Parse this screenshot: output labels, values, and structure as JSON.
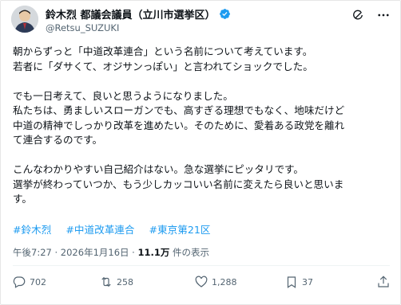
{
  "post": {
    "author_name": "鈴木烈 都議会議員（立川市選挙区）",
    "author_handle": "@Retsu_SUZUKI",
    "lines": [
      "朝からずっと「中道改革連合」という名前について考えています。",
      "若者に「ダサくて、オジサンっぽい」と言われてショックでした。",
      "",
      "でも一日考えて、良いと思うようになりました。",
      "私たちは、勇ましいスローガンでも、高すぎる理想でもなく、地味だけど",
      "中道の精神でしっかり改革を進めたい。そのために、愛着ある政党を離れ",
      "て連合するのです。",
      "",
      "こんなわかりやすい自己紹介はない。急な選挙にピッタリです。",
      "選挙が終わっていつか、もう少しカッコいい名前に変えたら良いと思いま",
      "す。"
    ],
    "hashtags": [
      "#鈴木烈",
      "#中道改革連合",
      "#東京第21区"
    ],
    "time": "午後7:27",
    "date": "2026年1月16日",
    "views_count": "11.1万",
    "views_label": "件の表示",
    "separator": "·"
  },
  "actions": {
    "replies": "702",
    "reposts": "258",
    "likes": "1,288",
    "bookmarks": "37"
  },
  "icons": {
    "verified": "verified-badge-icon",
    "grok": "grok-icon",
    "more": "more-icon",
    "reply": "reply-icon",
    "repost": "repost-icon",
    "like": "like-icon",
    "bookmark": "bookmark-icon",
    "share": "share-icon"
  },
  "colors": {
    "link": "#1d9bf0",
    "secondary": "#536471",
    "verified": "#1d9bf0"
  }
}
